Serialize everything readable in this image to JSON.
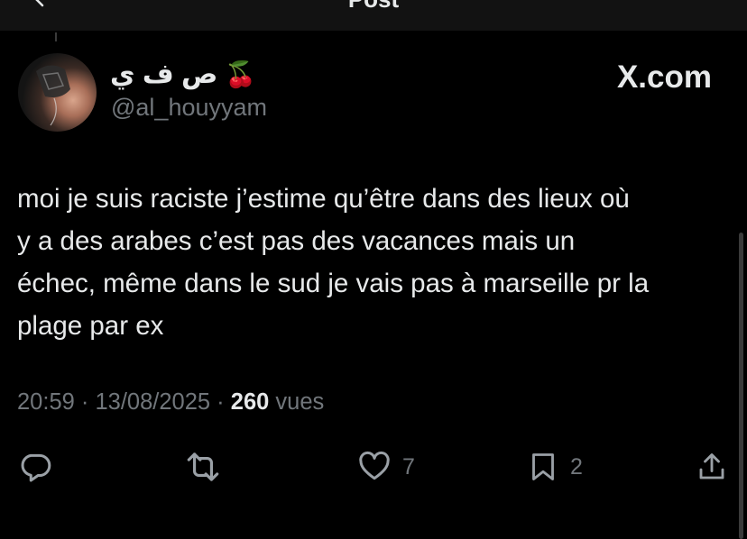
{
  "header": {
    "title": "Post",
    "back_icon": "arrow-left-icon"
  },
  "author": {
    "display_name": "ص ف ي",
    "emoji": "🍒",
    "handle": "@al_houyyam",
    "avatar": "profile-photo"
  },
  "source_label": "X.com",
  "tweet": {
    "text": "moi je suis raciste j’estime qu’être dans des lieux où\ny a des arabes c’est pas des vacances mais un\néchec, même dans le sud je vais pas à marseille pr la\nplage par ex",
    "timestamp": "20:59 · 13/08/2025 · ",
    "views_count": "260",
    "views_label": " vues"
  },
  "actions": {
    "reply": {
      "icon": "reply-icon"
    },
    "repost": {
      "icon": "repost-icon"
    },
    "like": {
      "icon": "heart-icon",
      "count": "7"
    },
    "bookmark": {
      "icon": "bookmark-icon",
      "count": "2"
    },
    "share": {
      "icon": "share-icon"
    }
  },
  "colors": {
    "background": "#000000",
    "text": "#e7e9ea",
    "muted": "#71767b",
    "cherry": "#e0243d"
  }
}
